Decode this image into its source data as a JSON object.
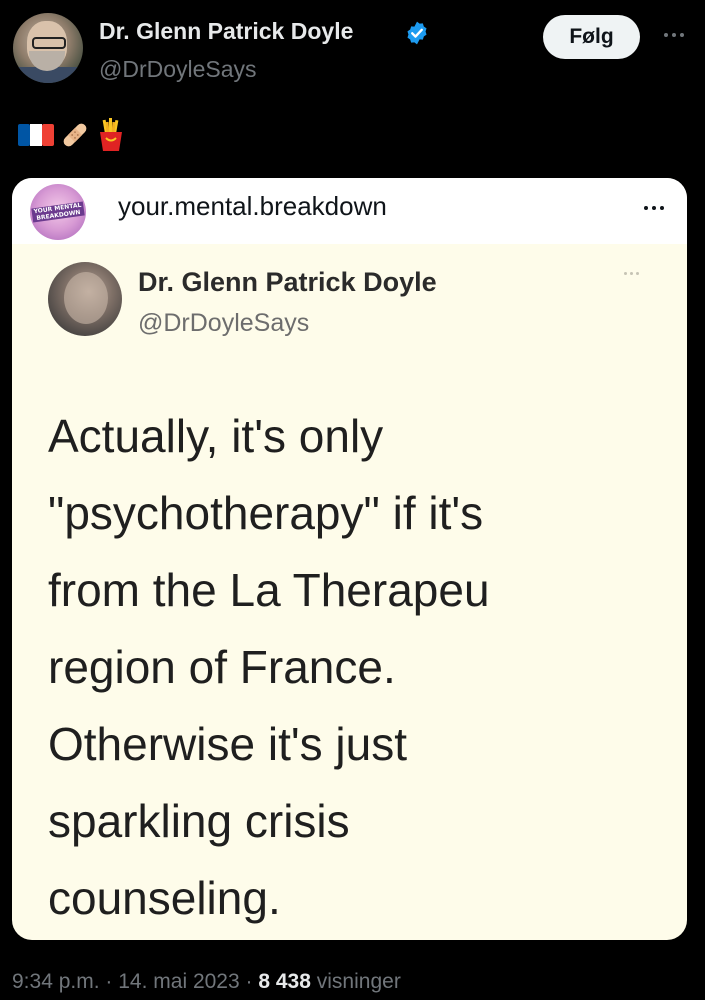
{
  "author": {
    "name": "Dr. Glenn Patrick Doyle",
    "handle": "@DrDoyleSays",
    "verified_icon": "verified-badge-icon",
    "verified_color": "#1d9bf0"
  },
  "header": {
    "follow_label": "Følg",
    "more_icon": "more-horizontal-icon"
  },
  "bio_emojis": [
    "flag-france-icon",
    "adhesive-bandage-icon",
    "french-fries-icon"
  ],
  "quoted_card": {
    "account": "your.mental.breakdown",
    "avatar_text": "YOUR MENTAL BREAKDOWN",
    "more_icon": "more-horizontal-icon",
    "inner_tweet": {
      "name": "Dr. Glenn Patrick Doyle",
      "handle": "@DrDoyleSays",
      "lines": [
        "Actually, it's only",
        "\"psychotherapy\" if it's",
        "from the La Therapeu",
        "region of France.",
        "Otherwise it's just",
        "sparkling crisis",
        "counseling."
      ]
    }
  },
  "footer": {
    "time": "9:34 p.m.",
    "separator": "·",
    "date": "14. mai 2023",
    "views_count": "8 438",
    "views_label": "visninger"
  },
  "colors": {
    "background": "#000000",
    "card_background": "#fefcea",
    "muted_text": "#71767b"
  }
}
